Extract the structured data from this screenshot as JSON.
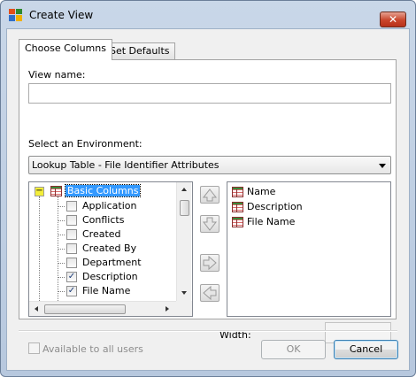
{
  "window": {
    "title": "Create View"
  },
  "tabs": [
    {
      "label": "Choose Columns"
    },
    {
      "label": "Set Defaults"
    }
  ],
  "form": {
    "view_name_label": "View name:",
    "view_name_value": "",
    "environment_label": "Select an Environment:",
    "environment_value": "Lookup Table - File Identifier Attributes",
    "width_label": "Width:",
    "width_value": ""
  },
  "tree": {
    "root": {
      "label": "Basic Columns",
      "expanded": true,
      "selected": true
    },
    "items": [
      {
        "label": "Application",
        "checked": false
      },
      {
        "label": "Conflicts",
        "checked": false
      },
      {
        "label": "Created",
        "checked": false
      },
      {
        "label": "Created By",
        "checked": false
      },
      {
        "label": "Department",
        "checked": false
      },
      {
        "label": "Description",
        "checked": true
      },
      {
        "label": "File Name",
        "checked": true
      }
    ]
  },
  "selected_columns": [
    {
      "label": "Name"
    },
    {
      "label": "Description"
    },
    {
      "label": "File Name"
    }
  ],
  "footer": {
    "available_label": "Available to all users",
    "available_checked": false,
    "ok_label": "OK",
    "cancel_label": "Cancel"
  },
  "colors": {
    "selection": "#3399ff",
    "close_button": "#c9452b"
  },
  "icons": {
    "title": "create-view-icon",
    "column": "table-grid-icon",
    "move_up": "up-arrow-icon",
    "move_down": "down-arrow-icon",
    "add": "right-arrow-icon",
    "remove": "left-arrow-icon"
  }
}
